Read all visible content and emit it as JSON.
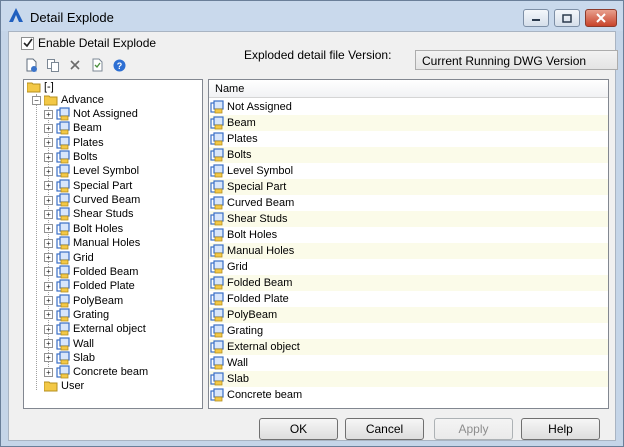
{
  "window": {
    "title": "Detail Explode"
  },
  "options": {
    "enable_checkbox_label": "Enable Detail Explode",
    "enable_checked": true,
    "version_label": "Exploded detail file Version:",
    "version_value": "Current Running DWG Version"
  },
  "toolbar": {
    "icons": [
      "new-file-icon",
      "copy-icon",
      "delete-icon",
      "properties-icon",
      "help-icon"
    ]
  },
  "tree": {
    "root_label": "[-]",
    "advance_label": "Advance",
    "children": [
      "Not Assigned",
      "Beam",
      "Plates",
      "Bolts",
      "Level Symbol",
      "Special Part",
      "Curved Beam",
      "Shear Studs",
      "Bolt Holes",
      "Manual Holes",
      "Grid",
      "Folded Beam",
      "Folded Plate",
      "PolyBeam",
      "Grating",
      "External object",
      "Wall",
      "Slab",
      "Concrete beam"
    ],
    "user_label": "User"
  },
  "list": {
    "header": "Name",
    "items": [
      "Not Assigned",
      "Beam",
      "Plates",
      "Bolts",
      "Level Symbol",
      "Special Part",
      "Curved Beam",
      "Shear Studs",
      "Bolt Holes",
      "Manual Holes",
      "Grid",
      "Folded Beam",
      "Folded Plate",
      "PolyBeam",
      "Grating",
      "External object",
      "Wall",
      "Slab",
      "Concrete beam"
    ]
  },
  "buttons": {
    "ok": "OK",
    "cancel": "Cancel",
    "apply": "Apply",
    "help": "Help"
  },
  "colors": {
    "title_bar": "#c9d9ec",
    "close_button": "#c8432b",
    "alt_row": "#fbfbe9",
    "folder": "#f3c846",
    "layer_blue": "#3a6fc6"
  }
}
